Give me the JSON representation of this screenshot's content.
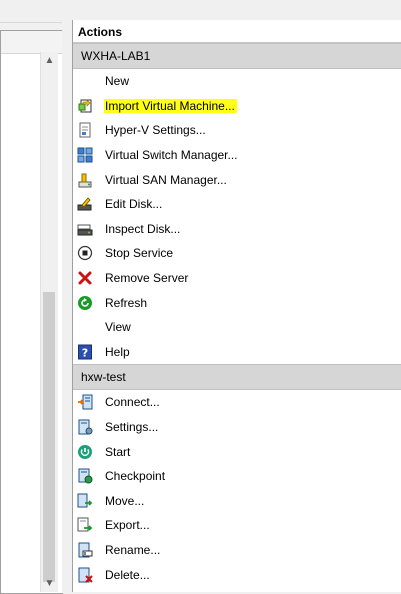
{
  "actions_pane": {
    "title": "Actions",
    "sections": [
      {
        "header": "WXHA-LAB1",
        "items": [
          {
            "label": "New",
            "icon": "none"
          },
          {
            "label": "Import Virtual Machine...",
            "icon": "import-vm-icon",
            "highlighted": true
          },
          {
            "label": "Hyper-V Settings...",
            "icon": "settings-document-icon"
          },
          {
            "label": "Virtual Switch Manager...",
            "icon": "virtual-switch-icon"
          },
          {
            "label": "Virtual SAN Manager...",
            "icon": "virtual-san-icon"
          },
          {
            "label": "Edit Disk...",
            "icon": "edit-disk-icon"
          },
          {
            "label": "Inspect Disk...",
            "icon": "inspect-disk-icon"
          },
          {
            "label": "Stop Service",
            "icon": "stop-icon"
          },
          {
            "label": "Remove Server",
            "icon": "red-x-icon"
          },
          {
            "label": "Refresh",
            "icon": "refresh-icon"
          },
          {
            "label": "View",
            "icon": "none"
          },
          {
            "label": "Help",
            "icon": "help-icon"
          }
        ]
      },
      {
        "header": "hxw-test",
        "items": [
          {
            "label": "Connect...",
            "icon": "connect-icon"
          },
          {
            "label": "Settings...",
            "icon": "vm-settings-icon"
          },
          {
            "label": "Start",
            "icon": "start-icon"
          },
          {
            "label": "Checkpoint",
            "icon": "checkpoint-icon"
          },
          {
            "label": "Move...",
            "icon": "move-icon"
          },
          {
            "label": "Export...",
            "icon": "export-icon"
          },
          {
            "label": "Rename...",
            "icon": "rename-icon"
          },
          {
            "label": "Delete...",
            "icon": "delete-icon"
          }
        ]
      }
    ]
  },
  "colors": {
    "highlight": "#ffff1a",
    "section_header_bg": "#d6d6d6",
    "stop_red": "#cc1111",
    "refresh_green": "#1a9a2a",
    "help_blue": "#2b4faf"
  }
}
